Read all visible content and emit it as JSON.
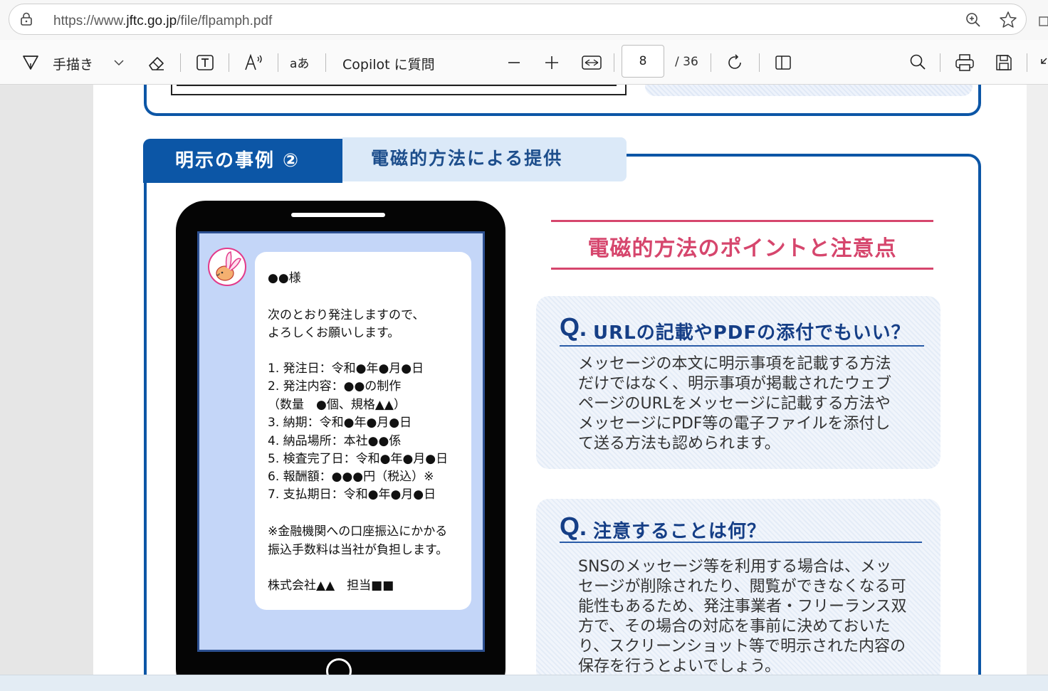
{
  "browser": {
    "url_prefix": "https://www.",
    "url_host": "jftc.go.jp",
    "url_path": "/file/flpamph.pdf"
  },
  "toolbar": {
    "draw_label": "手描き",
    "copilot_label": "Copilot に質問",
    "page_current": "8",
    "page_total": "/ 36"
  },
  "section": {
    "tab_label": "明示の事例 ②",
    "tab_subtitle": "電磁的方法による提供"
  },
  "message": {
    "lines": [
      "●●様",
      "次のとおり発注しますので、",
      "よろしくお願いします。",
      "1. 発注日：令和●年●月●日",
      "2. 発注内容：●●の制作",
      "（数量　●個、規格▲▲）",
      "3. 納期：令和●年●月●日",
      "4. 納品場所：本社●●係",
      "5. 検査完了日：令和●年●月●日",
      "6. 報酬額：●●●円（税込）※",
      "7. 支払期日：令和●年●月●日",
      "※金融機関への口座振込にかかる",
      "振込手数料は当社が負担します。",
      "株式会社▲▲　担当■■"
    ]
  },
  "points": {
    "title": "電磁的方法のポイントと注意点",
    "q_mark": "Q.",
    "q1": {
      "question": "URLの記載やPDFの添付でもいい？",
      "answer": [
        "メッセージの本文に明示事項を記載する方法",
        "だけではなく、明示事項が掲載されたウェブ",
        "ページのURLをメッセージに記載する方法や",
        "メッセージにPDF等の電子ファイルを添付し",
        "て送る方法も認められます。"
      ]
    },
    "q2": {
      "question": "注意することは何？",
      "answer": [
        "SNSのメッセージ等を利用する場合は、メッ",
        "セージが削除されたり、閲覧ができなくなる可",
        "能性もあるため、発注事業者・フリーランス双",
        "方で、その場合の対応を事前に決めておいた",
        "り、スクリーンショット等で明示された内容の",
        "保存を行うとよいでしょう。"
      ]
    }
  },
  "colors": {
    "brand_blue": "#0c56a6",
    "accent_pink": "#d6466d",
    "screen_blue": "#c4d6f8"
  }
}
